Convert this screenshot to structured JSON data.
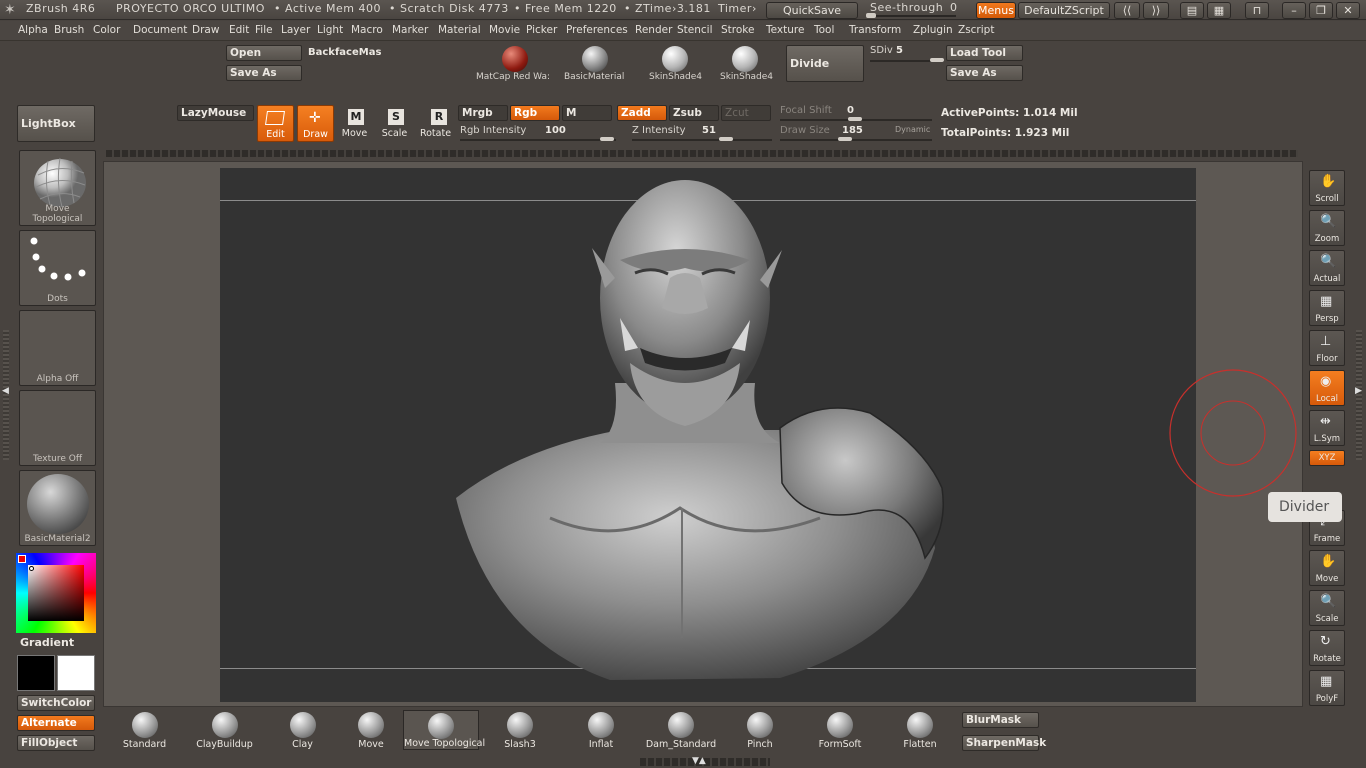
{
  "titlebar": {
    "app": "ZBrush 4R6",
    "project": "PROYECTO ORCO ULTIMO",
    "active_mem": "• Active Mem 400",
    "scratch": "• Scratch Disk 4773",
    "free_mem": "• Free Mem 1220",
    "ztime": "• ZTime›3.181",
    "timer": "Timer›",
    "quicksave": "QuickSave",
    "seethrough": "See-through",
    "seethrough_value": "0",
    "menus": "Menus",
    "script": "DefaultZScript"
  },
  "menubar": [
    "Alpha",
    "Brush",
    "Color",
    "Document",
    "Draw",
    "Edit",
    "File",
    "Layer",
    "Light",
    "Macro",
    "Marker",
    "Material",
    "Movie",
    "Picker",
    "Preferences",
    "Render",
    "Stencil",
    "Stroke",
    "Texture",
    "Tool",
    "Transform",
    "Zplugin",
    "Zscript"
  ],
  "top": {
    "open": "Open",
    "saveas1": "Save As",
    "backface": "BackfaceMas",
    "mat1": "MatCap Red Wa:",
    "mat2": "BasicMaterial",
    "mat3": "SkinShade4",
    "mat4": "SkinShade4",
    "divide": "Divide",
    "sdiv_label": "SDiv",
    "sdiv_value": "5",
    "loadtool": "Load Tool",
    "saveas2": "Save As",
    "lightbox": "LightBox",
    "lazymouse": "LazyMouse"
  },
  "transform": {
    "edit": "Edit",
    "draw": "Draw",
    "move": "Move",
    "scale": "Scale",
    "rotate": "Rotate",
    "move_key": "M",
    "scale_key": "S",
    "rotate_key": "R"
  },
  "draw": {
    "mrgb": "Mrgb",
    "rgb": "Rgb",
    "m": "M",
    "zadd": "Zadd",
    "zsub": "Zsub",
    "zcut": "Zcut",
    "rgb_int_label": "Rgb Intensity",
    "rgb_int_value": "100",
    "z_int_label": "Z Intensity",
    "z_int_value": "51",
    "focal_label": "Focal Shift",
    "focal_value": "0",
    "drawsize_label": "Draw Size",
    "drawsize_value": "185",
    "dynamic": "Dynamic",
    "activepoints": "ActivePoints: 1.014 Mil",
    "totalpoints": "TotalPoints: 1.923 Mil"
  },
  "leftshelf": {
    "brush": "Move Topological",
    "stroke": "Dots",
    "alpha": "Alpha Off",
    "texture": "Texture Off",
    "material": "BasicMaterial2",
    "gradient": "Gradient",
    "switchcolor": "SwitchColor",
    "alternate": "Alternate",
    "fillobject": "FillObject"
  },
  "rightshelf": [
    {
      "label": "Scroll",
      "icon": "hand-scroll-icon"
    },
    {
      "label": "Zoom",
      "icon": "zoom-icon"
    },
    {
      "label": "Actual",
      "icon": "actual-icon"
    },
    {
      "label": "Persp",
      "icon": "perspective-icon"
    },
    {
      "label": "Floor",
      "icon": "floor-icon"
    },
    {
      "label": "Local",
      "icon": "local-icon"
    },
    {
      "label": "L.Sym",
      "icon": "local-symmetry-icon"
    },
    {
      "label": "XYZ",
      "icon": "xyz-icon"
    },
    {
      "label": "Frame",
      "icon": "frame-icon"
    },
    {
      "label": "Move",
      "icon": "move-hand-icon"
    },
    {
      "label": "Scale",
      "icon": "scale-icon"
    },
    {
      "label": "Rotate",
      "icon": "rotate-icon"
    },
    {
      "label": "PolyF",
      "icon": "polyframe-icon"
    }
  ],
  "tooltip": "Divider",
  "bottom": {
    "brushes": [
      "Standard",
      "ClayBuildup",
      "Clay",
      "Move",
      "Move Topological",
      "Slash3",
      "Inflat",
      "Dam_Standard",
      "Pinch",
      "FormSoft",
      "Flatten"
    ],
    "blurmask": "BlurMask",
    "sharpenmask": "SharpenMask"
  },
  "colors": {
    "accent": "#e8690f",
    "canvas": "#333333",
    "ui": "#48433f"
  }
}
